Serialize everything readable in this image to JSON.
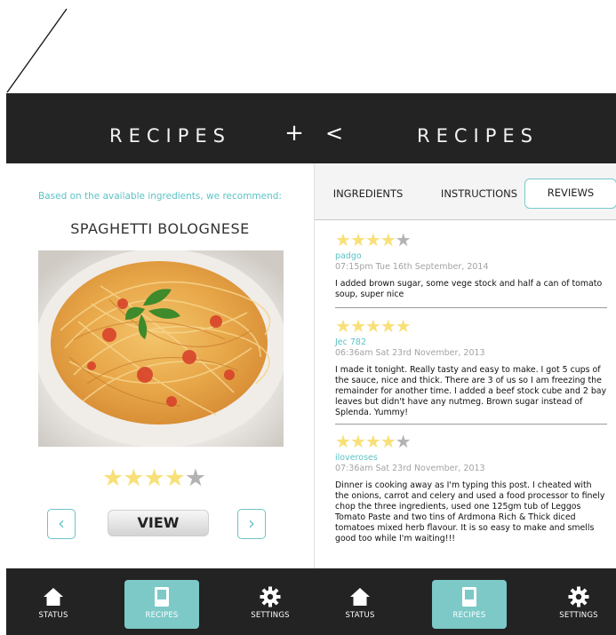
{
  "left_screen": {
    "title": "RECIPES",
    "add_icon": "plus-icon",
    "recommend_text": "Based on the available ingredients, we recommend:",
    "dish_name": "SPAGHETTI BOLOGNESE",
    "rating": 4,
    "rating_max": 5,
    "view_label": "VIEW",
    "prev_icon": "chevron-left-icon",
    "next_icon": "chevron-right-icon"
  },
  "right_screen": {
    "back_icon": "chevron-left-icon",
    "title": "RECIPES",
    "tabs": [
      {
        "label": "INGREDIENTS",
        "active": false
      },
      {
        "label": "INSTRUCTIONS",
        "active": false
      },
      {
        "label": "REVIEWS",
        "active": true
      }
    ],
    "reviews": [
      {
        "rating": 4,
        "author": "padgo",
        "time": "07:15pm Tue 16th September, 2014",
        "text": "I added brown sugar, some vege stock and half a can of tomato soup, super nice"
      },
      {
        "rating": 5,
        "author": "Jec 782",
        "time": "06:36am Sat 23rd November, 2013",
        "text": "I made it tonight. Really tasty and easy to make. I got 5 cups of the sauce, nice and thick. There are 3 of us so I am freezing the remainder for another time. I added a beef stock cube and 2 bay leaves but didn't have any nutmeg. Brown sugar instead of Splenda. Yummy!"
      },
      {
        "rating": 4,
        "author": "iloveroses",
        "time": "07:36am Sat 23rd November, 2013",
        "text": "Dinner is cooking away as I'm typing this post. I cheated with the onions, carrot and celery and used a food processor to finely chop the three ingredients, used one 125gm tub of Leggos Tomato Paste and two tins of Ardmona Rich & Thick diced tomatoes mixed herb flavour. It is so easy to make and smells good too while I'm waiting!!!"
      }
    ]
  },
  "nav": [
    {
      "label": "STATUS",
      "icon": "home-icon",
      "active": false
    },
    {
      "label": "RECIPES",
      "icon": "book-icon",
      "active": true
    },
    {
      "label": "SETTINGS",
      "icon": "gear-icon",
      "active": false
    },
    {
      "label": "STATUS",
      "icon": "home-icon",
      "active": false
    },
    {
      "label": "RECIPES",
      "icon": "book-icon",
      "active": true
    },
    {
      "label": "SETTINGS",
      "icon": "gear-icon",
      "active": false
    }
  ],
  "colors": {
    "accent": "#7cc9c8",
    "header_bg": "#232323",
    "star_filled": "#f8e079",
    "star_empty": "#b3b3b3"
  }
}
